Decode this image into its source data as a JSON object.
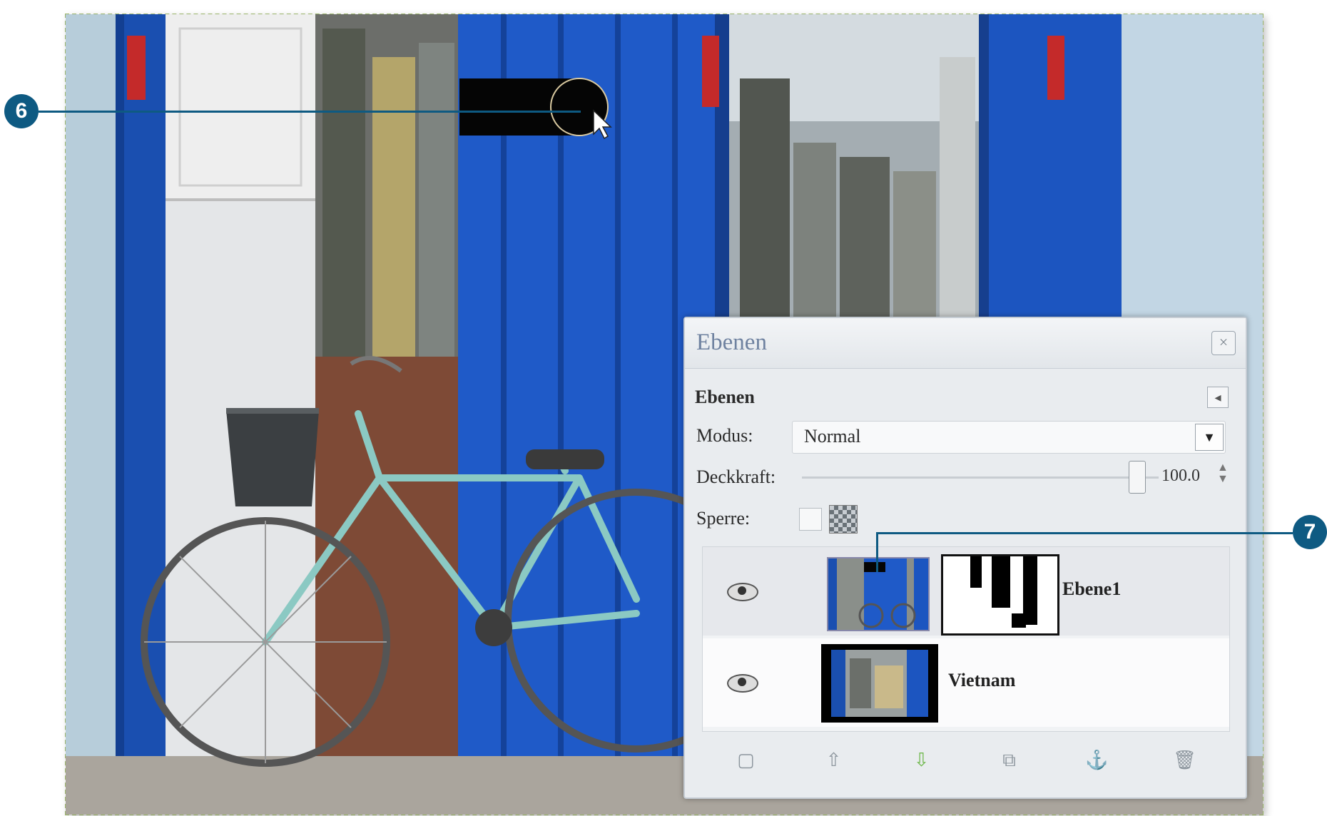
{
  "callouts": {
    "c6": "6",
    "c7": "7"
  },
  "layers_dialog": {
    "title": "Ebenen",
    "section_header": "Ebenen",
    "mode_label": "Modus:",
    "mode_value": "Normal",
    "opacity_label": "Deckkraft:",
    "opacity_value": "100.0",
    "lock_label": "Sperre:",
    "layers": [
      {
        "name": "Ebene1",
        "visible": true,
        "has_mask": true
      },
      {
        "name": "Vietnam",
        "visible": true,
        "has_mask": false
      }
    ],
    "footer_tools": [
      "new-layer-icon",
      "raise-layer-icon",
      "lower-layer-icon",
      "duplicate-layer-icon",
      "anchor-layer-icon",
      "delete-layer-icon"
    ]
  },
  "colors": {
    "callout": "#0e5a82",
    "door_blue": "#1450b8",
    "wall": "#cfdde6",
    "bike": "#8cc8c4"
  }
}
